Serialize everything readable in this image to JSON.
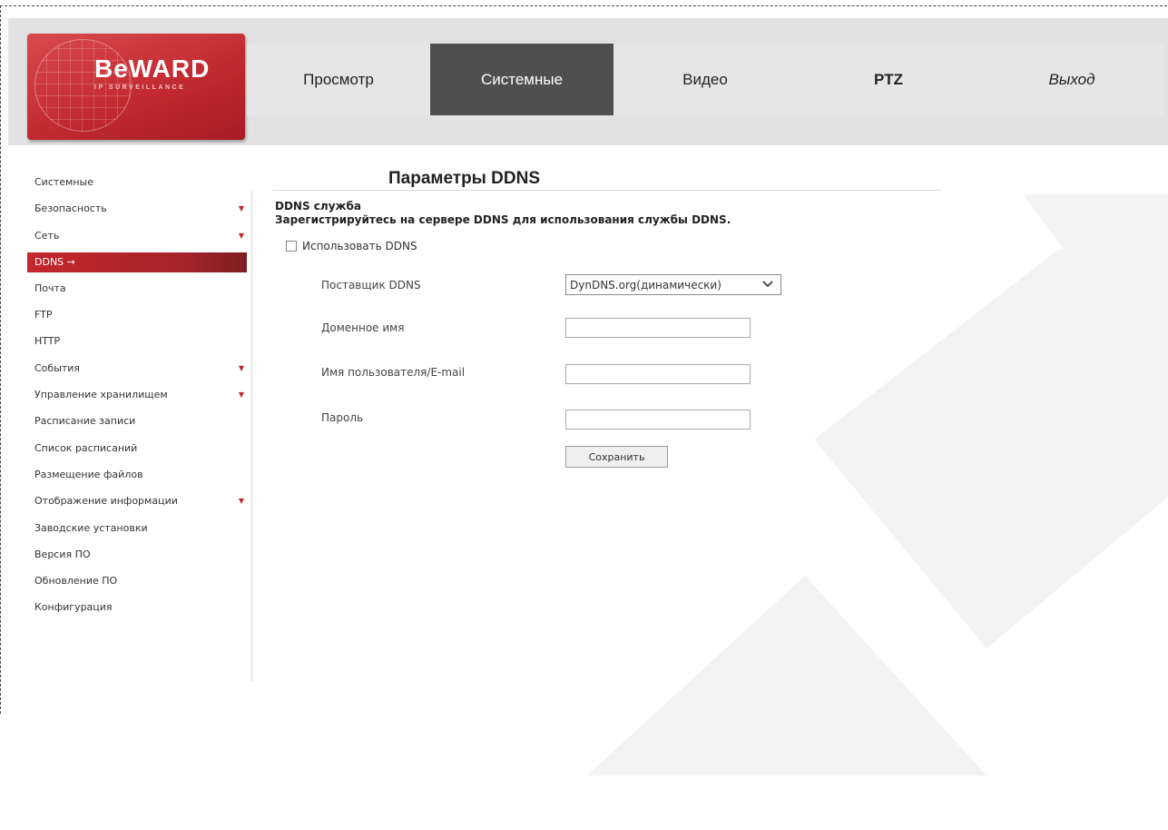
{
  "logo": {
    "brand": "BeWARD",
    "tagline": "IP SURVEILLANCE"
  },
  "nav": {
    "tabs": [
      {
        "label": "Просмотр"
      },
      {
        "label": "Системные"
      },
      {
        "label": "Видео"
      },
      {
        "label": "PTZ"
      },
      {
        "label": "Выход"
      }
    ]
  },
  "sidebar": {
    "items": [
      {
        "label": "Системные"
      },
      {
        "label": "Безопасность"
      },
      {
        "label": "Сеть"
      },
      {
        "label": "DDNS →"
      },
      {
        "label": "Почта"
      },
      {
        "label": "FTP"
      },
      {
        "label": "HTTP"
      },
      {
        "label": "События"
      },
      {
        "label": "Управление хранилищем"
      },
      {
        "label": "Расписание записи"
      },
      {
        "label": "Список расписаний"
      },
      {
        "label": "Размещение файлов"
      },
      {
        "label": "Отображение информации"
      },
      {
        "label": "Заводские установки"
      },
      {
        "label": "Версия ПО"
      },
      {
        "label": "Обновление ПО"
      },
      {
        "label": "Конфигурация"
      }
    ],
    "expand_glyph": "▼"
  },
  "main": {
    "title": "Параметры DDNS",
    "section_title": "DDNS служба",
    "section_subtitle": "Зарегистрируйтесь на сервере DDNS для использования службы DDNS.",
    "use_ddns_label": "Использовать DDNS",
    "provider_label": "Поставщик DDNS",
    "provider_value": "DynDNS.org(динамически)",
    "domain_label": "Доменное имя",
    "username_label": "Имя пользователя/E-mail",
    "password_label": "Пароль",
    "save_label": "Сохранить"
  },
  "colors": {
    "accent_red": "#c4262c",
    "active_tab": "#4f4f4f",
    "header_bg": "#e2e2e2"
  }
}
